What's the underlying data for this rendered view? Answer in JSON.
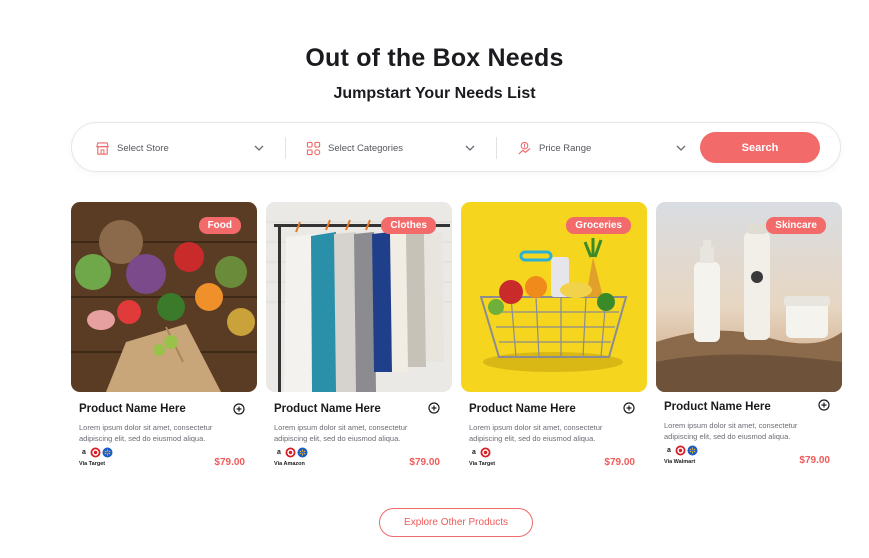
{
  "header": {
    "title": "Out of the Box Needs",
    "subtitle": "Jumpstart Your Needs List"
  },
  "search": {
    "store_label": "Select Store",
    "categories_label": "Select Categories",
    "price_label": "Price Range",
    "button_label": "Search",
    "store_icon": "store-icon",
    "categories_icon": "categories-grid-icon",
    "price_icon": "price-tag-icon"
  },
  "products": [
    {
      "category": "Food",
      "name": "Product Name Here",
      "description": "Lorem ipsum dolor sit amet, consectetur adipiscing elit, sed do eiusmod aliqua.",
      "via": "Via Target",
      "price": "$79.00"
    },
    {
      "category": "Clothes",
      "name": "Product Name Here",
      "description": "Lorem ipsum dolor sit amet, consectetur adipiscing elit, sed do eiusmod aliqua.",
      "via": "Via Amazon",
      "price": "$79.00"
    },
    {
      "category": "Groceries",
      "name": "Product Name Here",
      "description": "Lorem ipsum dolor sit amet, consectetur adipiscing elit, sed do eiusmod aliqua.",
      "via": "Via Target",
      "price": "$79.00"
    },
    {
      "category": "Skincare",
      "name": "Product Name Here",
      "description": "Lorem ipsum dolor sit amet, consectetur adipiscing elit, sed do eiusmod aliqua.",
      "via": "Via Walmart",
      "price": "$79.00"
    }
  ],
  "explore_label": "Explore Other Products",
  "colors": {
    "accent": "#f26a6a",
    "price": "#ef5a5a",
    "text": "#1b1b1f"
  }
}
